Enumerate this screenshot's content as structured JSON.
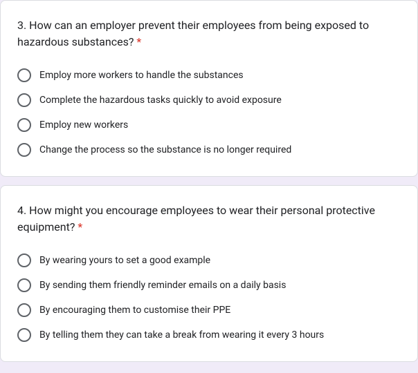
{
  "questions": [
    {
      "title": "3. How can an employer prevent their employees from being exposed to hazardous substances?",
      "required": "*",
      "options": [
        "Employ more workers to handle the substances",
        "Complete the hazardous tasks quickly to avoid exposure",
        "Employ new workers",
        "Change the process so the substance is no longer required"
      ]
    },
    {
      "title": "4. How might you encourage employees to wear their personal protective equipment?",
      "required": "*",
      "options": [
        "By wearing yours to set a good example",
        "By sending them friendly reminder emails on a daily basis",
        "By encouraging them to customise their PPE",
        "By telling them they can take a break from wearing it every 3 hours"
      ]
    }
  ]
}
